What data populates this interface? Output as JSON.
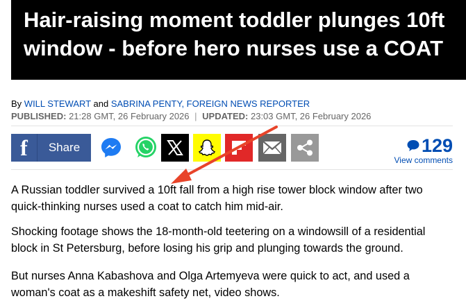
{
  "headline": {
    "line1": "Hair-raising moment toddler plunges 10ft",
    "line2": "window - before hero nurses use a COAT"
  },
  "byline": {
    "prefix": "By",
    "author1": "WILL STEWART",
    "joiner": "and",
    "author2": "SABRINA PENTY, FOREIGN NEWS REPORTER"
  },
  "dates": {
    "published_label": "PUBLISHED:",
    "published_value": "21:28 GMT, 26 February 2026",
    "separator": "|",
    "updated_label": "UPDATED:",
    "updated_value": "23:03 GMT, 26 February 2026"
  },
  "share": {
    "facebook_label": "Share",
    "icons": [
      "facebook-icon",
      "messenger-icon",
      "whatsapp-icon",
      "x-icon",
      "snapchat-icon",
      "flipboard-icon",
      "email-icon",
      "share-icon"
    ],
    "colors": {
      "facebook": "#3a5a98",
      "whatsapp": "#25d366",
      "x": "#000000",
      "snapchat": "#fffc00",
      "flipboard": "#e12828",
      "email": "#666666",
      "share": "#999999"
    }
  },
  "comments": {
    "count": "129",
    "link": "View comments",
    "color": "#004db3"
  },
  "paragraphs": [
    "A Russian toddler survived a 10ft fall from a high rise tower block window after two quick-thinking nurses used a coat to catch him mid-air.",
    "Shocking footage shows the 18-month-old teetering on a windowsill of a residential block in St Petersburg, before losing his grip and plunging towards the ground.",
    "But nurses Anna Kabashova and Olga Artemyeva were quick to act, and used a woman's coat as a makeshift safety net, video shows."
  ],
  "annotation": {
    "arrow_color": "#e8442a"
  }
}
